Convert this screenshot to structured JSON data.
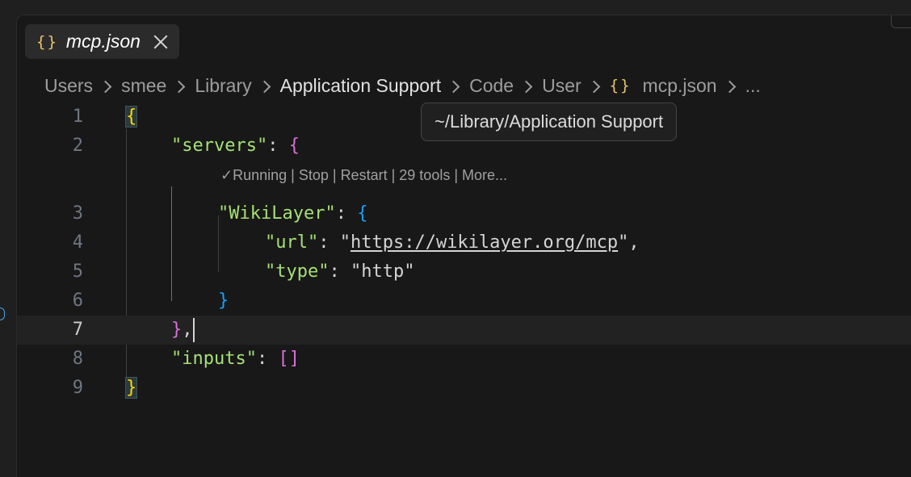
{
  "tab": {
    "icon": "{}",
    "label": "mcp.json"
  },
  "breadcrumb": {
    "items": [
      "Users",
      "smee",
      "Library",
      "Application Support",
      "Code",
      "User"
    ],
    "file_icon": "{}",
    "file": "mcp.json",
    "more": "..."
  },
  "tooltip": {
    "text": "~/Library/Application Support"
  },
  "codelens": {
    "check": "✓",
    "running": "Running",
    "sep": " | ",
    "stop": "Stop",
    "restart": "Restart",
    "tools": "29 tools",
    "more": "More..."
  },
  "editor": {
    "line_numbers": [
      "1",
      "2",
      "3",
      "4",
      "5",
      "6",
      "7",
      "8",
      "9"
    ],
    "current_line": "7",
    "tokens": {
      "open_brace": "{",
      "servers_key": "\"servers\"",
      "colon_space": ": ",
      "wikilayer_key": "\"WikiLayer\"",
      "url_key": "\"url\"",
      "url_quote_open": "\"",
      "url_value": "https://wikilayer.org/mcp",
      "url_quote_close": "\"",
      "comma": ",",
      "type_key": "\"type\"",
      "type_value": "\"http\"",
      "close_brace": "}",
      "inputs_key": "\"inputs\"",
      "empty_array": "[]"
    }
  },
  "colors": {
    "background": "#181818",
    "key": "#a5e075",
    "brace_yellow": "#ffd700",
    "brace_purple": "#da70d6",
    "brace_blue": "#179fff"
  }
}
